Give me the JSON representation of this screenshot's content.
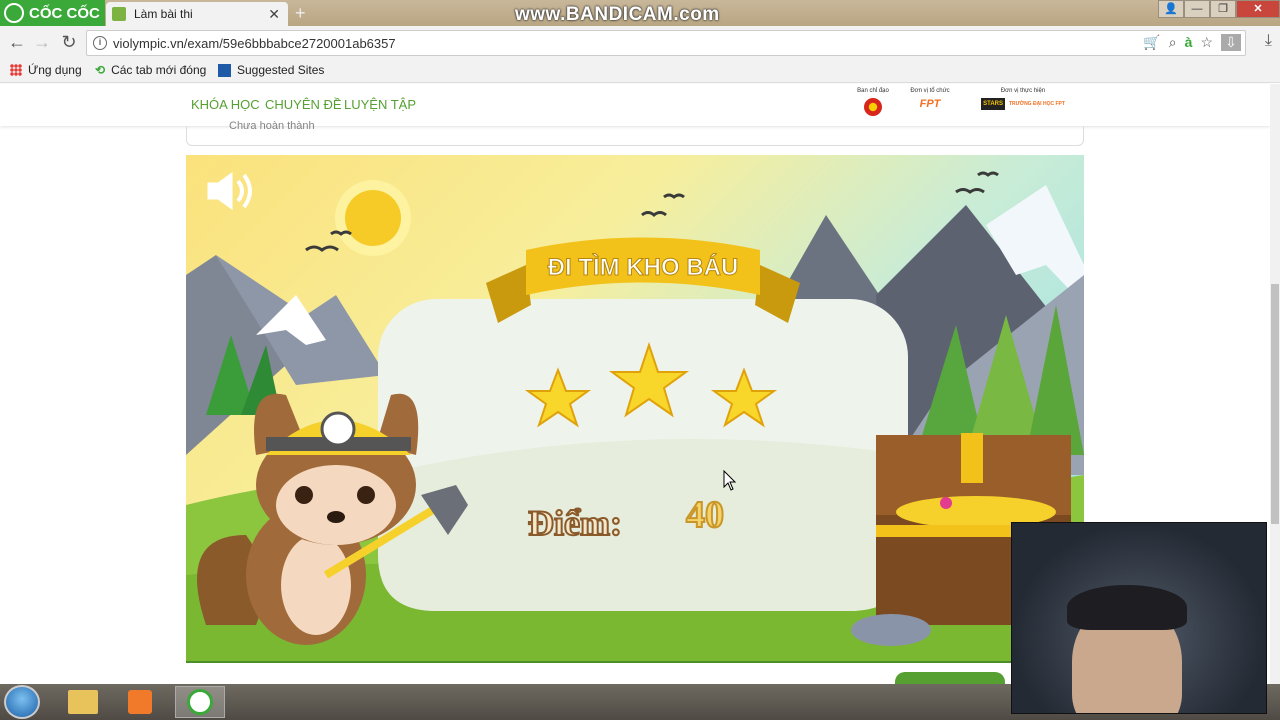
{
  "browser": {
    "brand": "CỐC CỐC",
    "tab_title": "Làm bài thi",
    "watermark": "www.BANDICAM.com",
    "url": "violympic.vn/exam/59e6bbbabce2720001ab6357"
  },
  "bookmarks": {
    "apps": "Ứng dụng",
    "recent_tabs": "Các tab mới đóng",
    "suggested": "Suggested Sites"
  },
  "site": {
    "menu": [
      "KHÓA HỌC",
      "CHUYÊN ĐỀ",
      "LUYỆN TẬP"
    ],
    "sponsors": [
      "Ban chỉ đạo",
      "Đơn vị tổ chức",
      "Đơn vị thực hiện"
    ],
    "sponsor_logo_text": [
      "FPT",
      "STARS",
      "TRƯỜNG ĐẠI HỌC FPT"
    ],
    "status_text": "Chưa hoàn thành"
  },
  "game": {
    "banner": "ĐI TÌM KHO BÁU",
    "score_label": "Điểm:",
    "score_value": "40",
    "stars_earned": 3,
    "stars_total": 3
  },
  "colors": {
    "brand_green": "#3aa93a",
    "menu_green": "#56a032",
    "banner_yellow": "#f2c21b",
    "score_brown": "#8a5a2b",
    "score_gold": "#c9962a"
  }
}
